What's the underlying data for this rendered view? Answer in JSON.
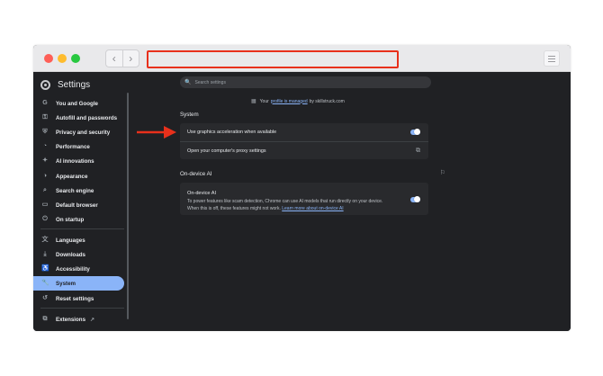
{
  "window": {
    "back_glyph": "‹",
    "forward_glyph": "›"
  },
  "app": {
    "title": "Settings",
    "logo_icon": "chrome-logo-icon"
  },
  "sidebar": {
    "items": [
      {
        "label": "You and Google",
        "icon": "G"
      },
      {
        "label": "Autofill and passwords",
        "icon": "⚿"
      },
      {
        "label": "Privacy and security",
        "icon": "⛨"
      },
      {
        "label": "Performance",
        "icon": "◔"
      },
      {
        "label": "AI innovations",
        "icon": "✦"
      },
      {
        "label": "Appearance",
        "icon": "◑"
      },
      {
        "label": "Search engine",
        "icon": "⌕"
      },
      {
        "label": "Default browser",
        "icon": "▭"
      },
      {
        "label": "On startup",
        "icon": "⏻"
      },
      {
        "label": "Languages",
        "icon": "文"
      },
      {
        "label": "Downloads",
        "icon": "⤓"
      },
      {
        "label": "Accessibility",
        "icon": "♿"
      },
      {
        "label": "System",
        "icon": "🔧"
      },
      {
        "label": "Reset settings",
        "icon": "↺"
      },
      {
        "label": "Extensions",
        "icon": "⧉"
      }
    ],
    "active_item": "System",
    "extensions_external_glyph": "↗"
  },
  "search": {
    "placeholder": "Search settings",
    "icon_glyph": "🔍"
  },
  "managed_notice": {
    "prefix": "Your",
    "link": "profile is managed",
    "suffix": "by skillstruck.com",
    "icon_glyph": "▦"
  },
  "system_section": {
    "title": "System",
    "rows": [
      {
        "label": "Use graphics acceleration when available",
        "control": "toggle",
        "on": true
      },
      {
        "label": "Open your computer's proxy settings",
        "control": "external-link",
        "glyph": "⧉"
      }
    ]
  },
  "ondevice_section": {
    "title": "On-device AI",
    "feedback_glyph": "⚐",
    "card_title": "On-device AI",
    "description": "To power features like scam detection, Chrome can use AI models that run directly on your device. When this is off, these features might not work.",
    "learn_more": "Learn more about on-device AI",
    "toggle_on": true
  },
  "annotation": {
    "arrow_color": "#e8301b",
    "highlight_color": "#e8301b"
  },
  "colors": {
    "accent": "#8ab4f8",
    "background": "#202124",
    "card": "#292a2d"
  }
}
